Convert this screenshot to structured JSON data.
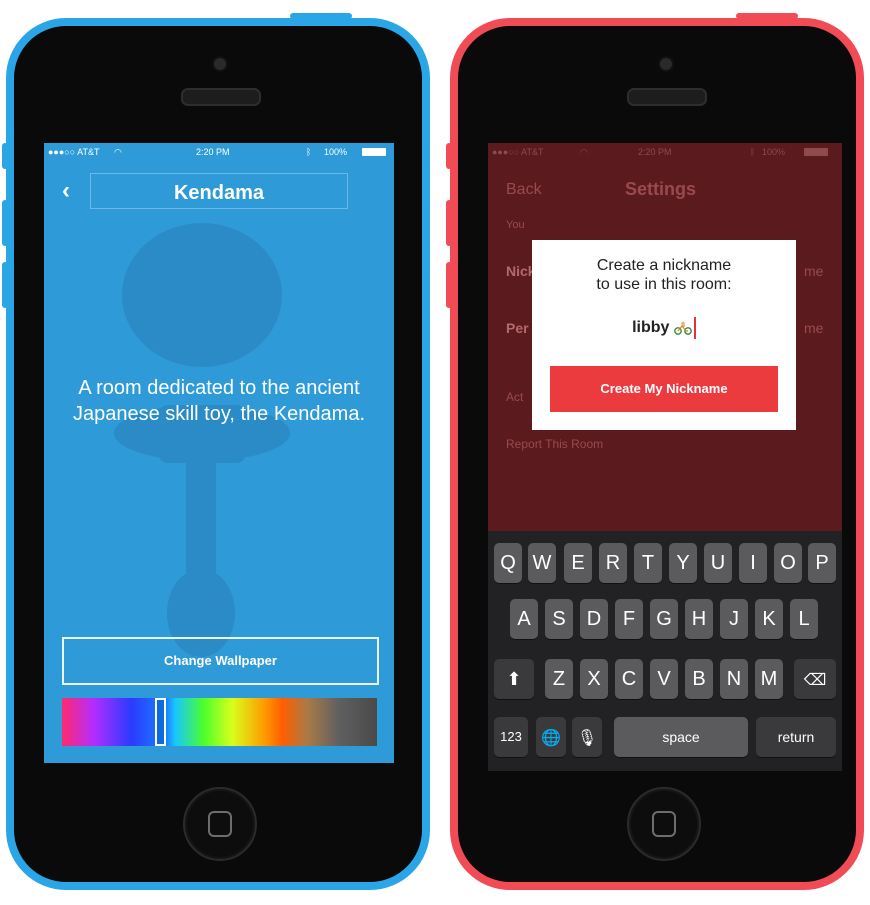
{
  "left_phone": {
    "status": {
      "carrier": "●●●○○ AT&T",
      "time": "2:20 PM",
      "battery": "100%"
    },
    "nav": {
      "back_icon": "chevron-left-icon",
      "title": "Kendama"
    },
    "description": "A room dedicated to the ancient Japanese skill toy, the Kendama.",
    "change_wallpaper_label": "Change Wallpaper",
    "accent_color": "#2e9ad8"
  },
  "right_phone": {
    "status": {
      "carrier": "●●●○○ AT&T",
      "time": "2:20 PM",
      "battery": "100%"
    },
    "background": {
      "back_label": "Back",
      "title": "Settings",
      "you_label": "You",
      "nick_label": "Nick",
      "per_label": "Per",
      "act_label": "Act",
      "name_partial_1": "me",
      "name_partial_2": "me",
      "report_label": "Report This Room"
    },
    "dialog": {
      "title_line1": "Create a nickname",
      "title_line2": "to use in this room:",
      "input_value": "libby",
      "input_emoji_icon": "bicycle-icon",
      "create_button_label": "Create My Nickname"
    },
    "keyboard": {
      "row1": [
        "Q",
        "W",
        "E",
        "R",
        "T",
        "Y",
        "U",
        "I",
        "O",
        "P"
      ],
      "row2": [
        "A",
        "S",
        "D",
        "F",
        "G",
        "H",
        "J",
        "K",
        "L"
      ],
      "row3": [
        "Z",
        "X",
        "C",
        "V",
        "B",
        "N",
        "M"
      ],
      "shift_icon": "shift-icon",
      "delete_icon": "delete-icon",
      "numbers_label": "123",
      "globe_icon": "globe-icon",
      "mic_icon": "microphone-icon",
      "space_label": "space",
      "return_label": "return"
    },
    "accent_color": "#ec3b3f"
  }
}
